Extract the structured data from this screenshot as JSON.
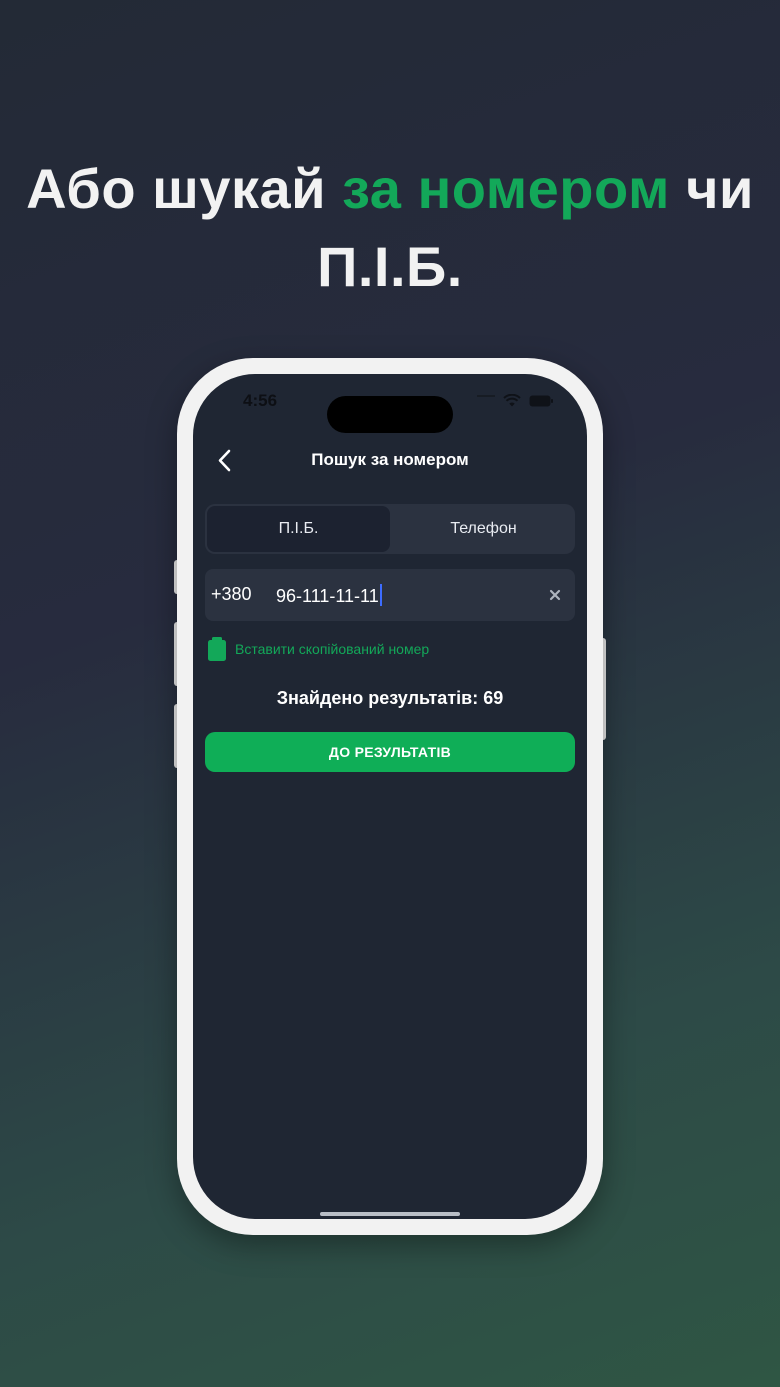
{
  "headline": {
    "part1": "Або шукай ",
    "accent": "за номером",
    "part2": " чи П.І.Б."
  },
  "status_bar": {
    "time": "4:56"
  },
  "nav": {
    "title": "Пошук за номером",
    "back_icon": "chevron-left-icon"
  },
  "segments": [
    {
      "label": "П.І.Б.",
      "active": true
    },
    {
      "label": "Телефон",
      "active": false
    }
  ],
  "phone_input": {
    "prefix": "+380",
    "value": "96-111-11-11"
  },
  "paste": {
    "label": "Вставити скопійований номер",
    "icon": "clipboard-icon"
  },
  "results": {
    "text": "Знайдено результатів: 69"
  },
  "cta": {
    "label": "ДО РЕЗУЛЬТАТІВ"
  },
  "colors": {
    "accent": "#13a859",
    "screen_bg": "#1f2633",
    "field_bg": "#2b3240",
    "button_bg": "#0fae57"
  }
}
